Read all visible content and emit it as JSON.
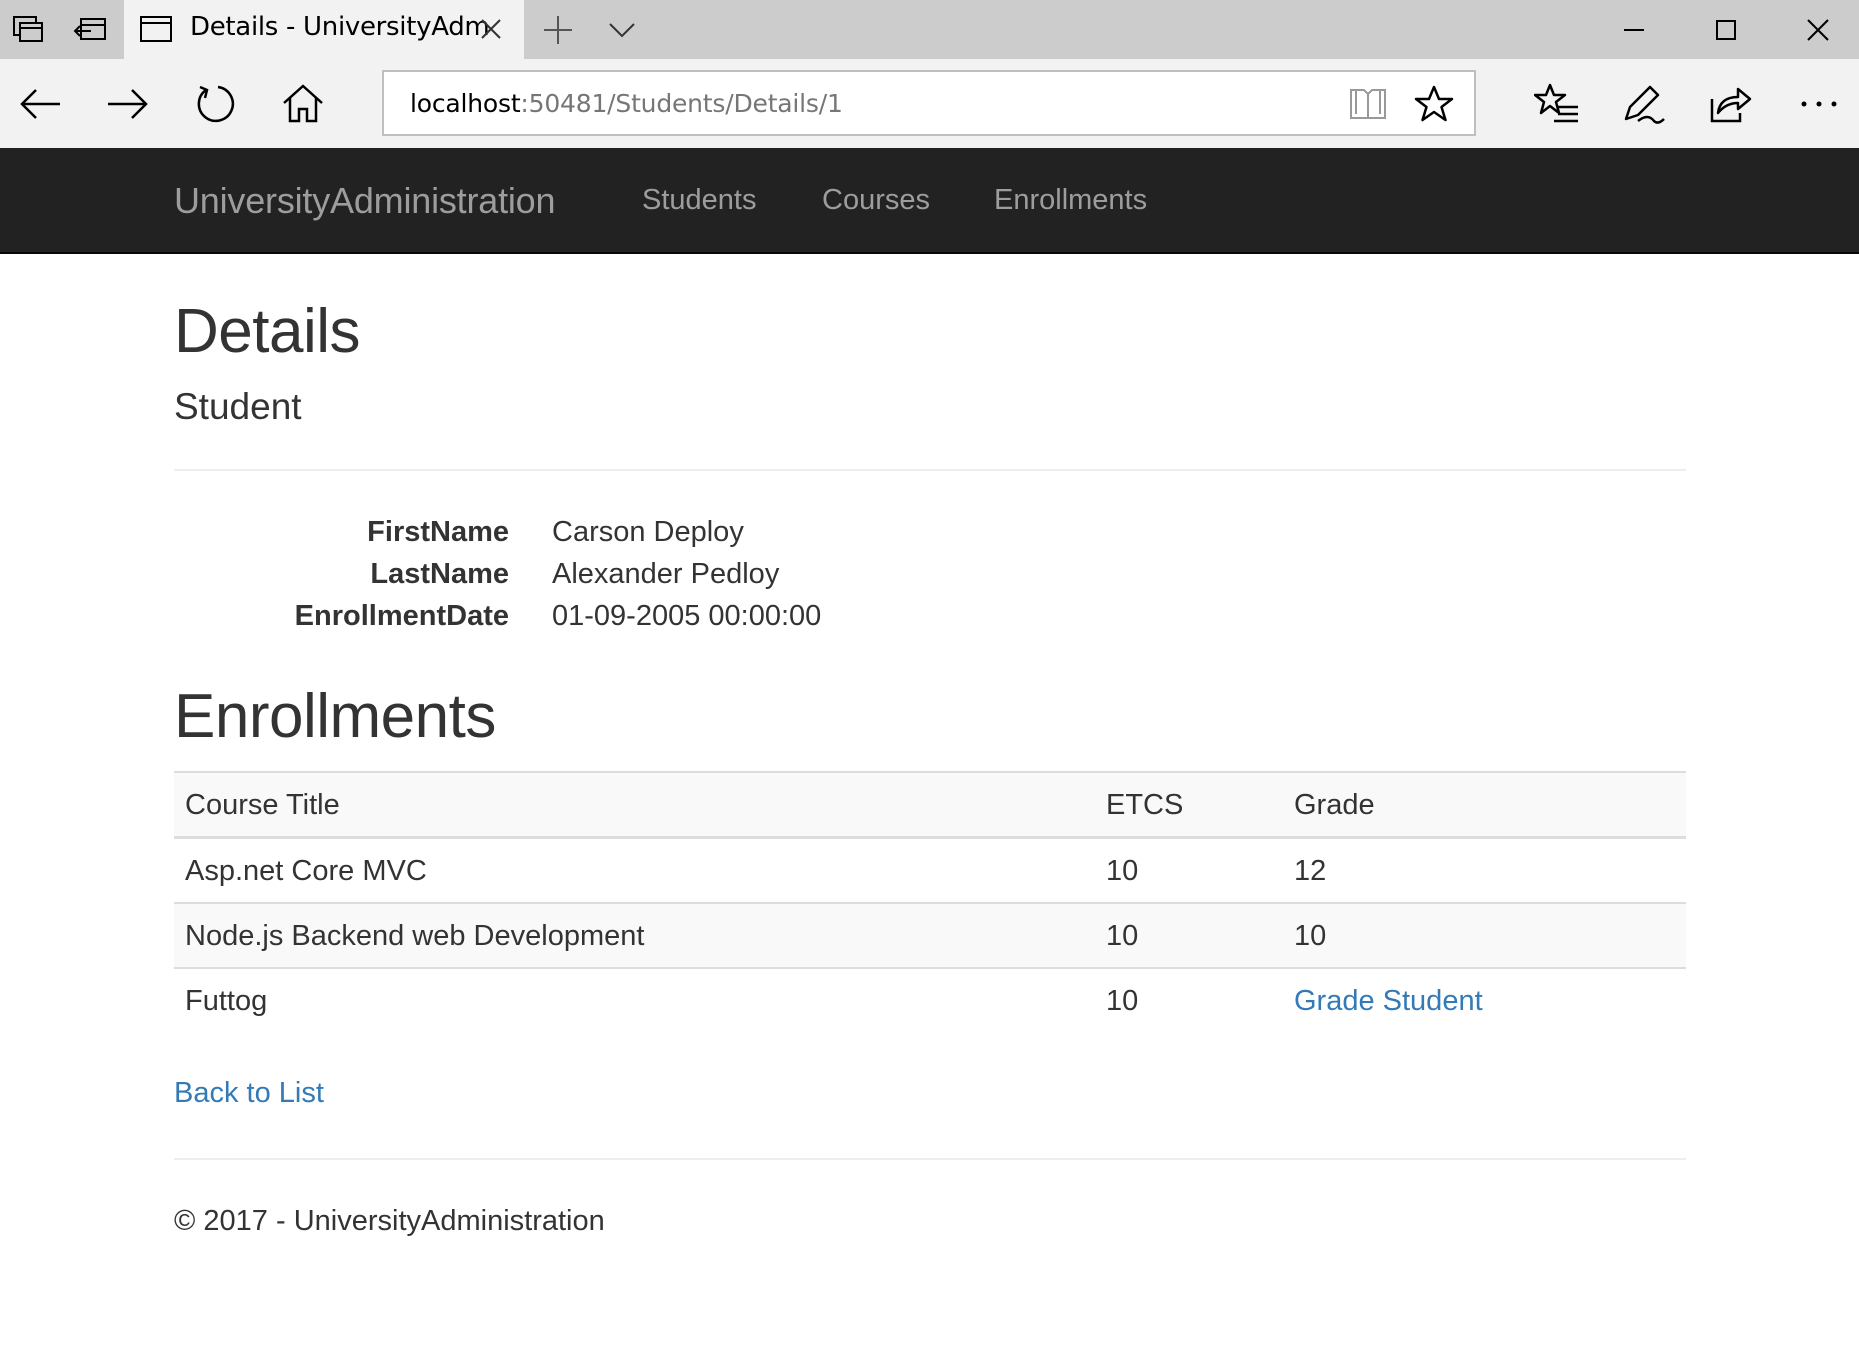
{
  "browser": {
    "tab_title": "Details - UniversityAdm",
    "url_host": "localhost",
    "url_path": ":50481/Students/Details/1"
  },
  "site": {
    "brand": "UniversityAdministration",
    "nav": [
      "Students",
      "Courses",
      "Enrollments"
    ]
  },
  "page": {
    "title": "Details",
    "subtitle": "Student",
    "fields": [
      {
        "label": "FirstName",
        "value": "Carson Deploy"
      },
      {
        "label": "LastName",
        "value": "Alexander Pedloy"
      },
      {
        "label": "EnrollmentDate",
        "value": "01-09-2005 00:00:00"
      }
    ],
    "enrollments_heading": "Enrollments",
    "table": {
      "headers": [
        "Course Title",
        "ETCS",
        "Grade"
      ],
      "rows": [
        {
          "course": "Asp.net Core MVC",
          "etcs": "10",
          "grade": "12"
        },
        {
          "course": "Node.js Backend web Development",
          "etcs": "10",
          "grade": "10"
        },
        {
          "course": "Futtog",
          "etcs": "10",
          "grade": "Grade Student"
        }
      ]
    },
    "back_link": "Back to List",
    "footer": "© 2017 - UniversityAdministration"
  },
  "colors": {
    "navbar_bg": "#222222",
    "nav_text": "#9d9d9d",
    "link": "#337ab7",
    "text": "#333333"
  }
}
